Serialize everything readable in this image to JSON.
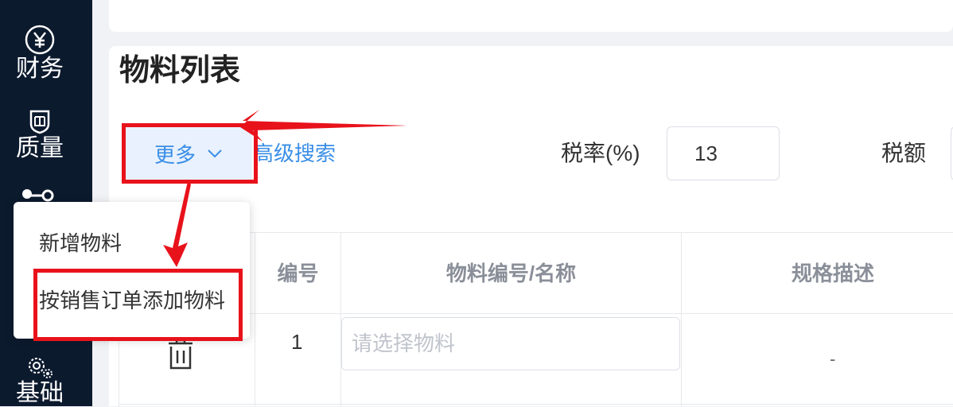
{
  "sidebar": {
    "items": [
      {
        "label": "财务",
        "icon": "yen-circle-icon"
      },
      {
        "label": "质量",
        "icon": "quality-shield-icon"
      },
      {
        "label": "基础",
        "icon": "gears-icon"
      }
    ]
  },
  "page": {
    "title": "物料列表"
  },
  "toolbar": {
    "more_label": "更多",
    "advanced_search_label": "高级搜索",
    "tax_rate_label": "税率(%)",
    "tax_rate_value": "13",
    "tax_amount_label": "税额"
  },
  "dropdown": {
    "items": [
      {
        "label": "新增物料"
      },
      {
        "label": "按销售订单添加物料"
      }
    ]
  },
  "table": {
    "columns": [
      "编号",
      "物料编号/名称",
      "规格描述"
    ],
    "rows": [
      {
        "number": "1",
        "material_placeholder": "请选择物料",
        "spec": "-"
      }
    ]
  },
  "colors": {
    "sidebar_bg": "#0c1a2e",
    "accent": "#3a8ee6",
    "annotation": "#e8121b"
  }
}
